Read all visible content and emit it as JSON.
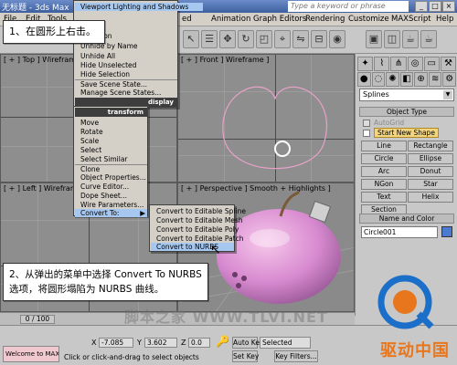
{
  "titlebar": {
    "title": "无标题 - 3ds Max",
    "search_hint": "Type a keyword or phrase",
    "window_buttons": [
      "_",
      "□",
      "×"
    ]
  },
  "menubar": {
    "items": [
      "File",
      "Edit",
      "Tools",
      "ed",
      "Animation",
      "Graph Editors",
      "Rendering",
      "Customize",
      "MAXScript",
      "Help"
    ]
  },
  "viewports": {
    "top": "[ + ] Top ] Wireframe ]",
    "front": "[ + ] Front ] Wireframe ]",
    "left": "[ + ] Left ] Wireframe ]",
    "perspective": "[ + ] Perspective ] Smooth + Highlights ]"
  },
  "quad_menu": {
    "top_item": "Viewport Lighting and Shadows",
    "display_items": [
      "ze All",
      "Selection",
      "Unhide by Name",
      "Unhide All",
      "Hide Unselected",
      "Hide Selection",
      "Save Scene State...",
      "Manage Scene States..."
    ],
    "display_header": "display",
    "transform_header": "transform",
    "transform_items": [
      "Move",
      "Rotate",
      "Scale",
      "Select",
      "Select Similar",
      "Clone",
      "Object Properties...",
      "Curve Editor...",
      "Dope Sheet...",
      "Wire Parameters...",
      "Convert To:"
    ],
    "convert_submenu_arrow": "▶",
    "submenu_items": [
      "Convert to Editable Spline",
      "Convert to Editable Mesh",
      "Convert to Editable Poly",
      "Convert to Editable Patch",
      "Convert to NURBS"
    ]
  },
  "callouts": {
    "step1": "1、在圆形上右击。",
    "step2": "2、从弹出的菜单中选择 Convert To NURBS\n选项，将圆形塌陷为 NURBS 曲线。"
  },
  "command_panel": {
    "category": "Splines",
    "object_type_header": "Object Type",
    "autogrid": "AutoGrid",
    "start_new_shape": "Start New Shape",
    "shape_buttons": [
      "Line",
      "Rectangle",
      "Circle",
      "Ellipse",
      "Arc",
      "Donut",
      "NGon",
      "Star",
      "Text",
      "Helix",
      "Section"
    ],
    "name_color_header": "Name and Color",
    "object_name": "Circle001",
    "object_color": "#4a7bd0"
  },
  "timeline": {
    "frame": "0 / 100"
  },
  "status": {
    "welcome": "Welcome to MAX",
    "prompt": "Click or click-and-drag to select objects",
    "x_label": "X",
    "x_value": "-7.085",
    "y_label": "Y",
    "y_value": "3.602",
    "z_label": "Z",
    "z_value": "0.0",
    "autokey": "Auto Key",
    "setkey": "Set Key",
    "selected": "Selected",
    "key_filters": "Key Filters..."
  },
  "watermark": "脚本之家 WWW.TLVI.NET",
  "logo": "驱动中国"
}
